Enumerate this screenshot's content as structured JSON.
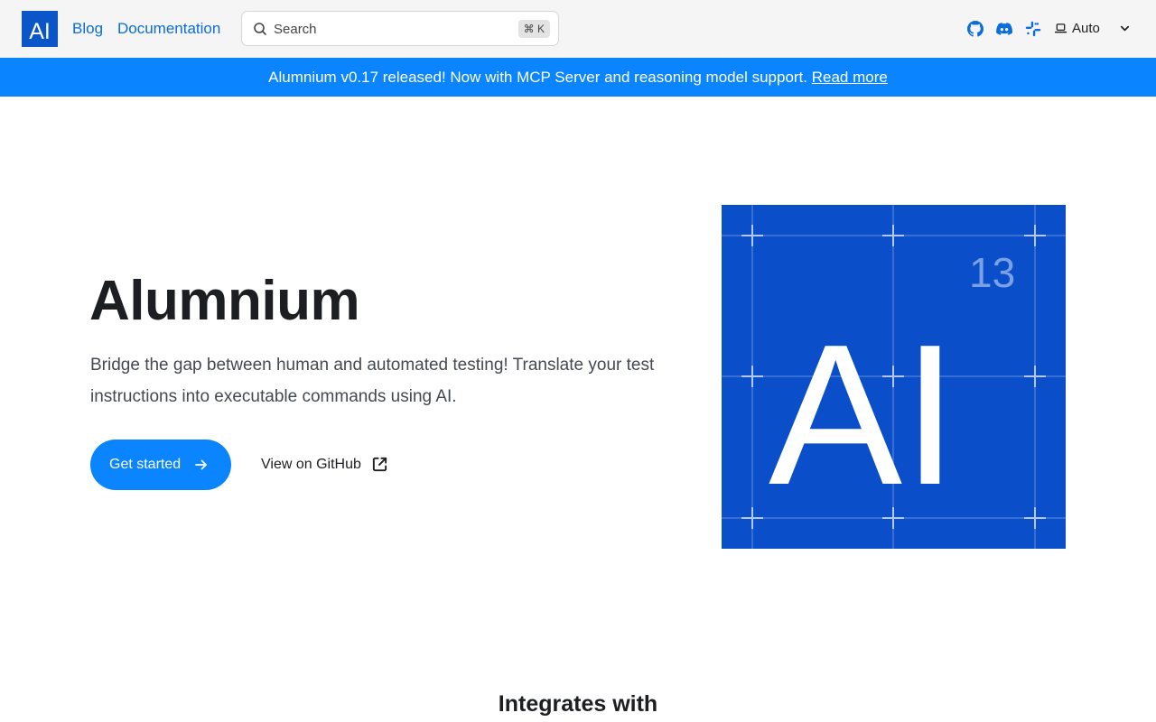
{
  "navbar": {
    "logo_text": "AI",
    "links": [
      {
        "label": "Blog"
      },
      {
        "label": "Documentation"
      }
    ],
    "search": {
      "placeholder": "Search",
      "shortcut": "⌘ K"
    },
    "icons": [
      "github-icon",
      "discord-icon",
      "slack-icon"
    ],
    "theme": {
      "label": "Auto"
    }
  },
  "announcement": {
    "text": "Alumnium v0.17 released! Now with MCP Server and reasoning model support.",
    "link_label": "Read more"
  },
  "hero": {
    "title": "Alumnium",
    "subtitle": "Bridge the gap between human and automated testing! Translate your test instructions into executable commands using AI.",
    "primary_button": "Get started",
    "secondary_button": "View on GitHub"
  },
  "element_tile": {
    "number": "13",
    "symbol": "AI"
  },
  "integrations": {
    "heading": "Integrates with"
  },
  "colors": {
    "primary": "#0a85ff",
    "link": "#0a6dd9",
    "tile_blue": "#0a4fc9",
    "navbar_bg": "#f5f5f5"
  }
}
